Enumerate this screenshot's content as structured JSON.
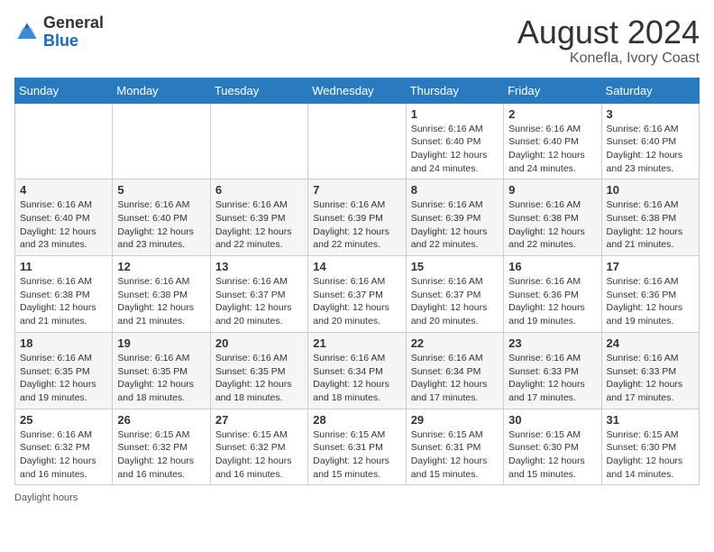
{
  "header": {
    "logo_general": "General",
    "logo_blue": "Blue",
    "month_year": "August 2024",
    "location": "Konefla, Ivory Coast"
  },
  "days_of_week": [
    "Sunday",
    "Monday",
    "Tuesday",
    "Wednesday",
    "Thursday",
    "Friday",
    "Saturday"
  ],
  "weeks": [
    [
      {
        "day": "",
        "info": ""
      },
      {
        "day": "",
        "info": ""
      },
      {
        "day": "",
        "info": ""
      },
      {
        "day": "",
        "info": ""
      },
      {
        "day": "1",
        "info": "Sunrise: 6:16 AM\nSunset: 6:40 PM\nDaylight: 12 hours\nand 24 minutes."
      },
      {
        "day": "2",
        "info": "Sunrise: 6:16 AM\nSunset: 6:40 PM\nDaylight: 12 hours\nand 24 minutes."
      },
      {
        "day": "3",
        "info": "Sunrise: 6:16 AM\nSunset: 6:40 PM\nDaylight: 12 hours\nand 23 minutes."
      }
    ],
    [
      {
        "day": "4",
        "info": "Sunrise: 6:16 AM\nSunset: 6:40 PM\nDaylight: 12 hours\nand 23 minutes."
      },
      {
        "day": "5",
        "info": "Sunrise: 6:16 AM\nSunset: 6:40 PM\nDaylight: 12 hours\nand 23 minutes."
      },
      {
        "day": "6",
        "info": "Sunrise: 6:16 AM\nSunset: 6:39 PM\nDaylight: 12 hours\nand 22 minutes."
      },
      {
        "day": "7",
        "info": "Sunrise: 6:16 AM\nSunset: 6:39 PM\nDaylight: 12 hours\nand 22 minutes."
      },
      {
        "day": "8",
        "info": "Sunrise: 6:16 AM\nSunset: 6:39 PM\nDaylight: 12 hours\nand 22 minutes."
      },
      {
        "day": "9",
        "info": "Sunrise: 6:16 AM\nSunset: 6:38 PM\nDaylight: 12 hours\nand 22 minutes."
      },
      {
        "day": "10",
        "info": "Sunrise: 6:16 AM\nSunset: 6:38 PM\nDaylight: 12 hours\nand 21 minutes."
      }
    ],
    [
      {
        "day": "11",
        "info": "Sunrise: 6:16 AM\nSunset: 6:38 PM\nDaylight: 12 hours\nand 21 minutes."
      },
      {
        "day": "12",
        "info": "Sunrise: 6:16 AM\nSunset: 6:38 PM\nDaylight: 12 hours\nand 21 minutes."
      },
      {
        "day": "13",
        "info": "Sunrise: 6:16 AM\nSunset: 6:37 PM\nDaylight: 12 hours\nand 20 minutes."
      },
      {
        "day": "14",
        "info": "Sunrise: 6:16 AM\nSunset: 6:37 PM\nDaylight: 12 hours\nand 20 minutes."
      },
      {
        "day": "15",
        "info": "Sunrise: 6:16 AM\nSunset: 6:37 PM\nDaylight: 12 hours\nand 20 minutes."
      },
      {
        "day": "16",
        "info": "Sunrise: 6:16 AM\nSunset: 6:36 PM\nDaylight: 12 hours\nand 19 minutes."
      },
      {
        "day": "17",
        "info": "Sunrise: 6:16 AM\nSunset: 6:36 PM\nDaylight: 12 hours\nand 19 minutes."
      }
    ],
    [
      {
        "day": "18",
        "info": "Sunrise: 6:16 AM\nSunset: 6:35 PM\nDaylight: 12 hours\nand 19 minutes."
      },
      {
        "day": "19",
        "info": "Sunrise: 6:16 AM\nSunset: 6:35 PM\nDaylight: 12 hours\nand 18 minutes."
      },
      {
        "day": "20",
        "info": "Sunrise: 6:16 AM\nSunset: 6:35 PM\nDaylight: 12 hours\nand 18 minutes."
      },
      {
        "day": "21",
        "info": "Sunrise: 6:16 AM\nSunset: 6:34 PM\nDaylight: 12 hours\nand 18 minutes."
      },
      {
        "day": "22",
        "info": "Sunrise: 6:16 AM\nSunset: 6:34 PM\nDaylight: 12 hours\nand 17 minutes."
      },
      {
        "day": "23",
        "info": "Sunrise: 6:16 AM\nSunset: 6:33 PM\nDaylight: 12 hours\nand 17 minutes."
      },
      {
        "day": "24",
        "info": "Sunrise: 6:16 AM\nSunset: 6:33 PM\nDaylight: 12 hours\nand 17 minutes."
      }
    ],
    [
      {
        "day": "25",
        "info": "Sunrise: 6:16 AM\nSunset: 6:32 PM\nDaylight: 12 hours\nand 16 minutes."
      },
      {
        "day": "26",
        "info": "Sunrise: 6:15 AM\nSunset: 6:32 PM\nDaylight: 12 hours\nand 16 minutes."
      },
      {
        "day": "27",
        "info": "Sunrise: 6:15 AM\nSunset: 6:32 PM\nDaylight: 12 hours\nand 16 minutes."
      },
      {
        "day": "28",
        "info": "Sunrise: 6:15 AM\nSunset: 6:31 PM\nDaylight: 12 hours\nand 15 minutes."
      },
      {
        "day": "29",
        "info": "Sunrise: 6:15 AM\nSunset: 6:31 PM\nDaylight: 12 hours\nand 15 minutes."
      },
      {
        "day": "30",
        "info": "Sunrise: 6:15 AM\nSunset: 6:30 PM\nDaylight: 12 hours\nand 15 minutes."
      },
      {
        "day": "31",
        "info": "Sunrise: 6:15 AM\nSunset: 6:30 PM\nDaylight: 12 hours\nand 14 minutes."
      }
    ]
  ],
  "footer": {
    "daylight_hours_label": "Daylight hours"
  }
}
